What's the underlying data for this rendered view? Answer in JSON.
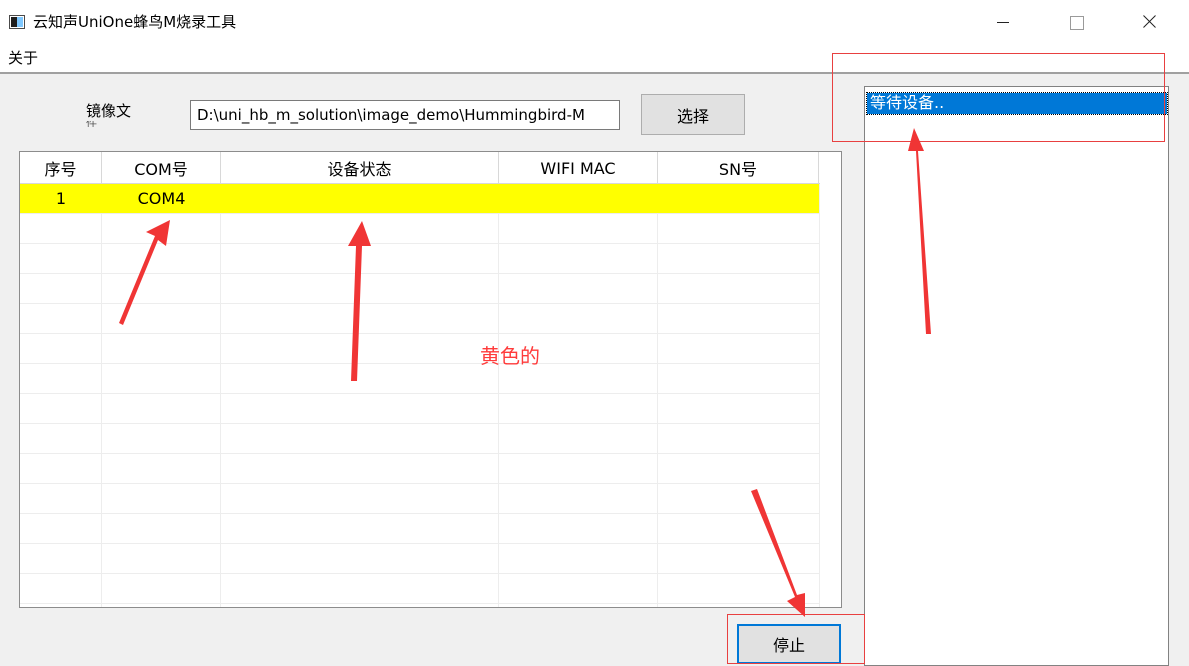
{
  "window": {
    "title": "云知声UniOne蜂鸟M烧录工具"
  },
  "menu": {
    "about": "关于"
  },
  "form": {
    "image_label": "镜像文",
    "image_label_cut": "件",
    "image_path": "D:\\uni_hb_m_solution\\image_demo\\Hummingbird-M",
    "select_button": "选择",
    "stop_button": "停止"
  },
  "table": {
    "columns": [
      "序号",
      "COM号",
      "设备状态",
      "WIFI MAC",
      "SN号"
    ],
    "rows": [
      {
        "index": "1",
        "com": "COM4",
        "status": "",
        "wifi_mac": "",
        "sn": ""
      }
    ],
    "selected_row_color": "#ffff00"
  },
  "log_list": {
    "items": [
      "等待设备.."
    ],
    "selected_color": "#0078d7"
  },
  "annotations": {
    "note": "黄色的",
    "color": "#ff3b3b"
  }
}
